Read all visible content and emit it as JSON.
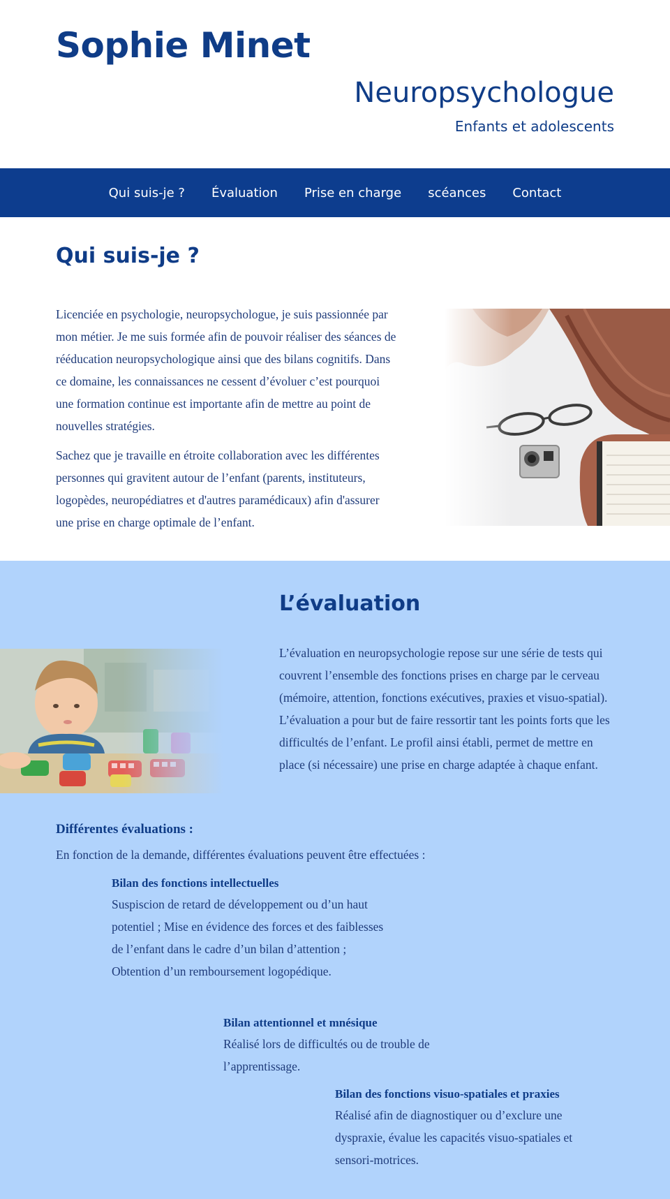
{
  "header": {
    "name": "Sophie Minet",
    "role": "Neuropsychologue",
    "subtitle": "Enfants et adolescents"
  },
  "nav": {
    "items": [
      {
        "label": "Qui suis-je ?"
      },
      {
        "label": "Évaluation"
      },
      {
        "label": "Prise en charge"
      },
      {
        "label": "scéances"
      },
      {
        "label": "Contact"
      }
    ]
  },
  "about": {
    "title": "Qui suis-je ?",
    "paragraphs": [
      "Licenciée en psychologie, neuropsychologue, je suis passionnée par mon métier. Je me suis formée afin de pouvoir réaliser des séances de rééducation neuropsychologique ainsi que des bilans cognitifs. Dans ce domaine, les connaissances ne cessent d’évoluer c’est pourquoi une formation continue est importante afin de mettre au point de nouvelles stratégies.",
      "Sachez que je travaille en étroite collaboration avec les différentes personnes qui gravitent autour de l’enfant (parents, instituteurs, logopèdes, neuropédiatres et d'autres paramédicaux) afin d'assurer une prise en charge optimale de l’enfant."
    ]
  },
  "evaluation": {
    "title": "L’évaluation",
    "intro": "L’évaluation en neuropsychologie repose sur une série de tests qui couvrent l’ensemble des fonctions prises en charge par le cerveau (mémoire, attention, fonctions exécutives, praxies et visuo-spatial). L’évaluation a pour but de faire ressortir tant les points forts que les difficultés de l’enfant. Le profil ainsi établi, permet de mettre en place (si nécessaire) une prise en charge adaptée à chaque enfant.",
    "diff_title": "Différentes évaluations :",
    "diff_intro": "En fonction de la demande, différentes évaluations peuvent être effectuées :",
    "bilans": [
      {
        "title": "Bilan des fonctions intellectuelles",
        "text": "Suspiscion de retard de développement ou d’un haut potentiel ; Mise en évidence des forces et des faiblesses de l’enfant dans le cadre d’un bilan d’attention ; Obtention d’un remboursement logopédique."
      },
      {
        "title": "Bilan attentionnel  et mnésique",
        "text": "Réalisé lors de difficultés ou de trouble de l’apprentissage."
      },
      {
        "title": "Bilan des fonctions visuo-spatiales et praxies",
        "text": "Réalisé afin de diagnostiquer ou d’exclure une dyspraxie, évalue les capacités visuo-spatiales et sensori-motrices."
      }
    ]
  },
  "colors": {
    "brand": "#0f3c87",
    "nav_bg": "#0d3d8e",
    "eval_bg": "#b1d3fc"
  }
}
